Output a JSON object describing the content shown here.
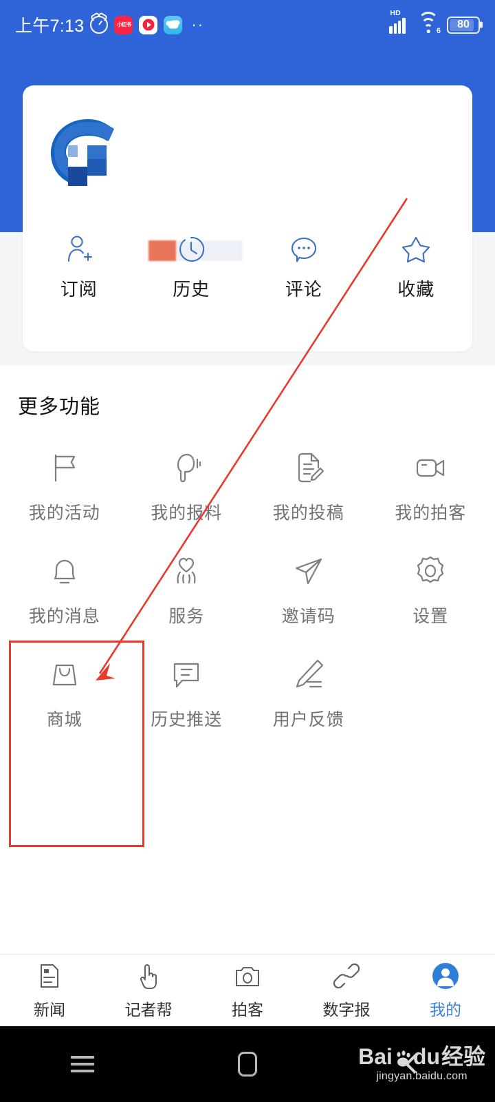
{
  "statusbar": {
    "time": "上午7:13",
    "icons": [
      {
        "name": "alarm-clock-icon",
        "label": "alarm"
      },
      {
        "name": "xiaohongshu-app-icon",
        "label": "小红书"
      },
      {
        "name": "video-app-icon",
        "label": "video"
      },
      {
        "name": "cloud-app-icon",
        "label": "cloud"
      }
    ],
    "overflow_dots": "··",
    "network_type": "HD",
    "wifi_generation": "6",
    "battery_percent": "80"
  },
  "profile": {
    "avatar_icon": "app-logo-avatar",
    "username_masked": "",
    "quick_actions": [
      {
        "label": "订阅",
        "icon": "user-add-icon"
      },
      {
        "label": "历史",
        "icon": "clock-history-icon"
      },
      {
        "label": "评论",
        "icon": "comment-bubble-icon"
      },
      {
        "label": "收藏",
        "icon": "star-icon"
      }
    ]
  },
  "more": {
    "title": "更多功能",
    "items": [
      {
        "label": "我的活动",
        "icon": "flag-icon"
      },
      {
        "label": "我的报料",
        "icon": "megaphone-icon"
      },
      {
        "label": "我的投稿",
        "icon": "document-edit-icon"
      },
      {
        "label": "我的拍客",
        "icon": "video-camera-icon"
      },
      {
        "label": "我的消息",
        "icon": "bell-icon"
      },
      {
        "label": "服务",
        "icon": "heart-hands-icon"
      },
      {
        "label": "邀请码",
        "icon": "paper-plane-icon"
      },
      {
        "label": "设置",
        "icon": "gear-icon"
      },
      {
        "label": "商城",
        "icon": "shopping-bag-icon"
      },
      {
        "label": "历史推送",
        "icon": "message-lines-icon"
      },
      {
        "label": "用户反馈",
        "icon": "pencil-write-icon"
      }
    ]
  },
  "bottom_nav": {
    "items": [
      {
        "label": "新闻",
        "icon": "news-document-icon",
        "active": false
      },
      {
        "label": "记者帮",
        "icon": "pointing-hand-icon",
        "active": false
      },
      {
        "label": "拍客",
        "icon": "camera-icon",
        "active": false
      },
      {
        "label": "数字报",
        "icon": "link-chain-icon",
        "active": false
      },
      {
        "label": "我的",
        "icon": "user-profile-icon",
        "active": true
      }
    ],
    "active_color": "#3b82e0"
  },
  "android_nav": {
    "recents_label": "recents",
    "home_label": "home",
    "back_label": "back"
  },
  "watermark": {
    "brand": "Bai",
    "brand2": "du",
    "suffix": "经验",
    "url": "jingyan.baidu.com"
  },
  "annotation": {
    "box_color": "#e8392b",
    "arrow_color": "#e8392b",
    "target": "商城"
  },
  "colors": {
    "header_blue": "#2f63d8",
    "accent_blue": "#3b82e0",
    "page_bg": "#f4f5f7",
    "icon_gray": "#6f7276"
  }
}
